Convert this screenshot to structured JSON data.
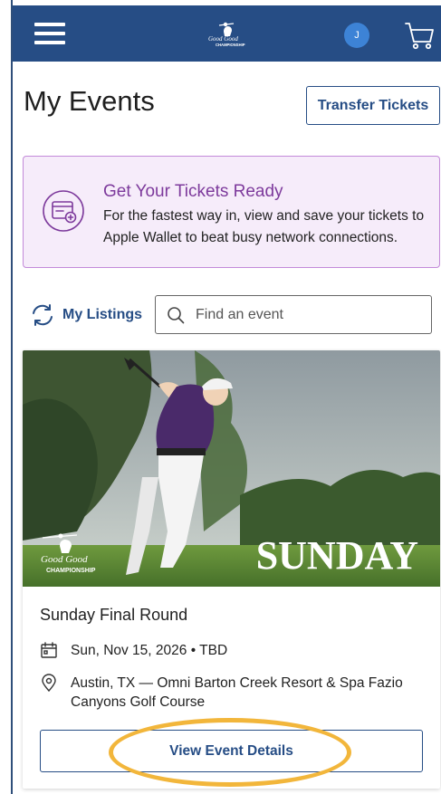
{
  "header": {
    "avatar_initial": "J",
    "logo_text_top": "Good Good",
    "logo_text_bottom": "CHAMPIONSHIP",
    "colors": {
      "bar": "#264d85",
      "avatar": "#3d83d6"
    }
  },
  "page": {
    "title": "My Events",
    "transfer_label": "Transfer Tickets"
  },
  "banner": {
    "heading": "Get Your Tickets Ready",
    "body": "For the fastest way in, view and save your tickets to Apple Wallet to beat busy network connections.",
    "colors": {
      "background": "#f6ecfa",
      "border": "#c38ad9",
      "heading": "#7d3a9c"
    }
  },
  "listings": {
    "label": "My Listings",
    "search_placeholder": "Find an event"
  },
  "event": {
    "image_text": "SUNDAY",
    "image_logo_top": "Good Good",
    "image_logo_bottom": "CHAMPIONSHIP",
    "title": "Sunday Final Round",
    "date": "Sun, Nov 15, 2026 • TBD",
    "location": "Austin, TX — Omni Barton Creek Resort & Spa Fazio Canyons Golf Course",
    "details_label": "View Event Details"
  },
  "annotation": {
    "color": "#f2b63b"
  }
}
